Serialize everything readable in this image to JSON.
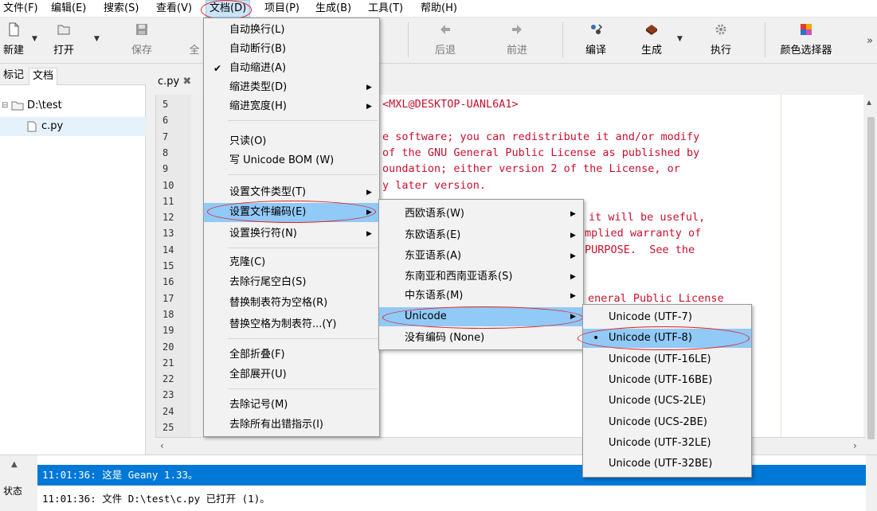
{
  "menubar": {
    "items": [
      {
        "label": "文件(F)"
      },
      {
        "label": "编辑(E)"
      },
      {
        "label": "搜索(S)"
      },
      {
        "label": "查看(V)"
      },
      {
        "label": "文档(D)"
      },
      {
        "label": "项目(P)"
      },
      {
        "label": "生成(B)"
      },
      {
        "label": "工具(T)"
      },
      {
        "label": "帮助(H)"
      }
    ]
  },
  "toolbar": {
    "new": "新建",
    "open": "打开",
    "save": "保存",
    "save_all": "全",
    "back": "后退",
    "forward": "前进",
    "compile": "编译",
    "build": "生成",
    "execute": "执行",
    "color_picker": "颜色选择器",
    "overflow": "»"
  },
  "sidebar": {
    "tabs": [
      "标记",
      "文档"
    ],
    "tree": [
      {
        "label": "D:\\test"
      },
      {
        "label": "c.py"
      }
    ]
  },
  "editor": {
    "tab_label": "c.py",
    "lines": [
      {
        "num": "5",
        "text": "<MXL@DESKTOP-UANL6A1>"
      },
      {
        "num": "6",
        "text": ""
      },
      {
        "num": "7",
        "text": "e software; you can redistribute it and/or modify"
      },
      {
        "num": "8",
        "text": "of the GNU General Public License as published by"
      },
      {
        "num": "9",
        "text": "oundation; either version 2 of the License, or"
      },
      {
        "num": "10",
        "text": "y later version."
      },
      {
        "num": "11",
        "text": ""
      },
      {
        "num": "12",
        "text": "it will be useful,"
      },
      {
        "num": "13",
        "text": "mplied warranty of"
      },
      {
        "num": "14",
        "text": "PURPOSE.  See the"
      },
      {
        "num": "15",
        "text": ""
      },
      {
        "num": "16",
        "text": ""
      },
      {
        "num": "17",
        "text": "eneral Public License"
      },
      {
        "num": "18",
        "text": ""
      },
      {
        "num": "19",
        "text": ""
      },
      {
        "num": "20",
        "text": ""
      },
      {
        "num": "21",
        "text": ""
      },
      {
        "num": "22",
        "text": ""
      },
      {
        "num": "23",
        "text": ""
      },
      {
        "num": "24",
        "text": ""
      },
      {
        "num": "25",
        "text": ""
      }
    ]
  },
  "document_menu": {
    "items": [
      {
        "label": "自动换行(L)"
      },
      {
        "label": "自动断行(B)"
      },
      {
        "label": "自动缩进(A)",
        "checked": "✔"
      },
      {
        "label": "缩进类型(D)"
      },
      {
        "label": "缩进宽度(H)"
      },
      {
        "label": "只读(O)"
      },
      {
        "label": "写 Unicode BOM (W)"
      },
      {
        "label": "设置文件类型(T)"
      },
      {
        "label": "设置文件编码(E)"
      },
      {
        "label": "设置换行符(N)"
      },
      {
        "label": "克隆(C)"
      },
      {
        "label": "去除行尾空白(S)"
      },
      {
        "label": "替换制表符为空格(R)"
      },
      {
        "label": "替换空格为制表符...(Y)"
      },
      {
        "label": "全部折叠(F)"
      },
      {
        "label": "全部展开(U)"
      },
      {
        "label": "去除记号(M)"
      },
      {
        "label": "去除所有出错指示(I)"
      }
    ]
  },
  "encoding_menu": {
    "items": [
      {
        "label": "西欧语系(W)"
      },
      {
        "label": "东欧语系(E)"
      },
      {
        "label": "东亚语系(A)"
      },
      {
        "label": "东南亚和西南亚语系(S)"
      },
      {
        "label": "中东语系(M)"
      },
      {
        "label": "Unicode"
      },
      {
        "label": "没有编码 (None)"
      }
    ]
  },
  "unicode_menu": {
    "selected_mark": "•",
    "items": [
      {
        "label": "Unicode (UTF-7)"
      },
      {
        "label": "Unicode (UTF-8)"
      },
      {
        "label": "Unicode (UTF-16LE)"
      },
      {
        "label": "Unicode (UTF-16BE)"
      },
      {
        "label": "Unicode (UCS-2LE)"
      },
      {
        "label": "Unicode (UCS-2BE)"
      },
      {
        "label": "Unicode (UTF-32LE)"
      },
      {
        "label": "Unicode (UTF-32BE)"
      }
    ]
  },
  "messages": {
    "side_label": "状态",
    "lines": [
      {
        "text": "11:01:36: 这是 Geany 1.33。"
      },
      {
        "text": "11:01:36: 文件 D:\\test\\c.py 已打开 (1)。"
      }
    ]
  },
  "colors": {
    "accent": "#0078d7",
    "menu_highlight": "#91c9f7",
    "code_text": "#c8102e",
    "annotation": "#e02020"
  }
}
